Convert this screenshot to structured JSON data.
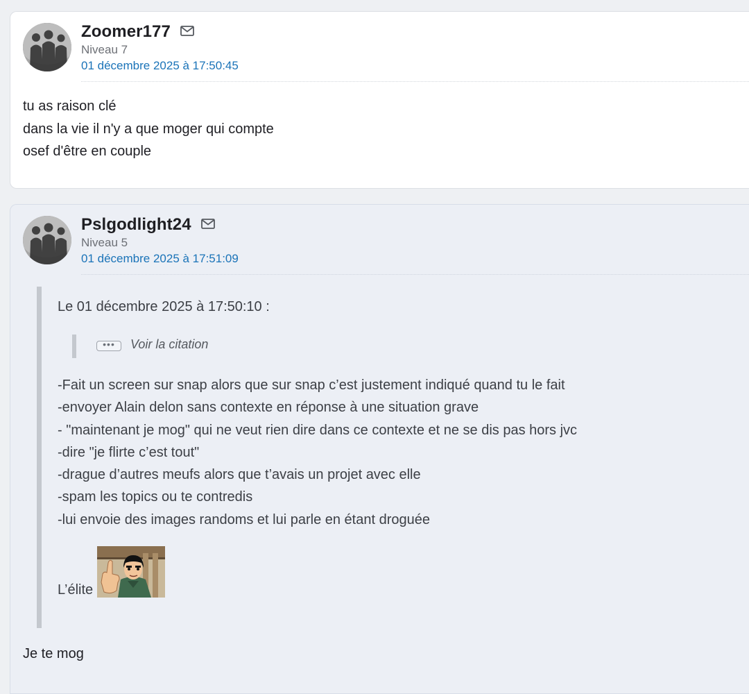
{
  "posts": [
    {
      "author": "Zoomer177",
      "level": "Niveau 7",
      "date": "01 décembre 2025 à 17:50:45",
      "lines": [
        "tu as raison clé",
        "dans la vie il n'y a que moger qui compte",
        "osef d'être en couple"
      ]
    },
    {
      "author": "Pslgodlight24",
      "level": "Niveau 5",
      "date": "01 décembre 2025 à 17:51:09",
      "quote": {
        "header": "Le 01 décembre 2025 à 17:50:10 :",
        "nested_dots": "•••",
        "nested_label": "Voir la citation",
        "lines": [
          "-Fait un screen sur snap alors que sur snap c’est justement indiqué quand tu le fait",
          "-envoyer Alain delon sans contexte en réponse à une situation grave",
          "- \"maintenant je mog\" qui ne veut rien dire dans ce contexte et ne se dis pas hors jvc",
          "-dire \"je flirte c’est tout\"",
          "-drague d’autres meufs alors que t’avais un projet avec elle",
          "-spam les topics ou te contredis",
          "-lui envoie des images randoms et lui parle en étant droguée"
        ],
        "closing": "L’élite"
      },
      "reply": "Je te mog"
    }
  ],
  "icons": {
    "message": "envelope-icon",
    "avatar": "group-silhouette-avatar",
    "sticker": "thumbs-up-character-sticker"
  },
  "colors": {
    "date_link": "#1a73b8",
    "quote_bar": "#c4c8ce",
    "highlighted_post_bg": "#eceff5"
  }
}
